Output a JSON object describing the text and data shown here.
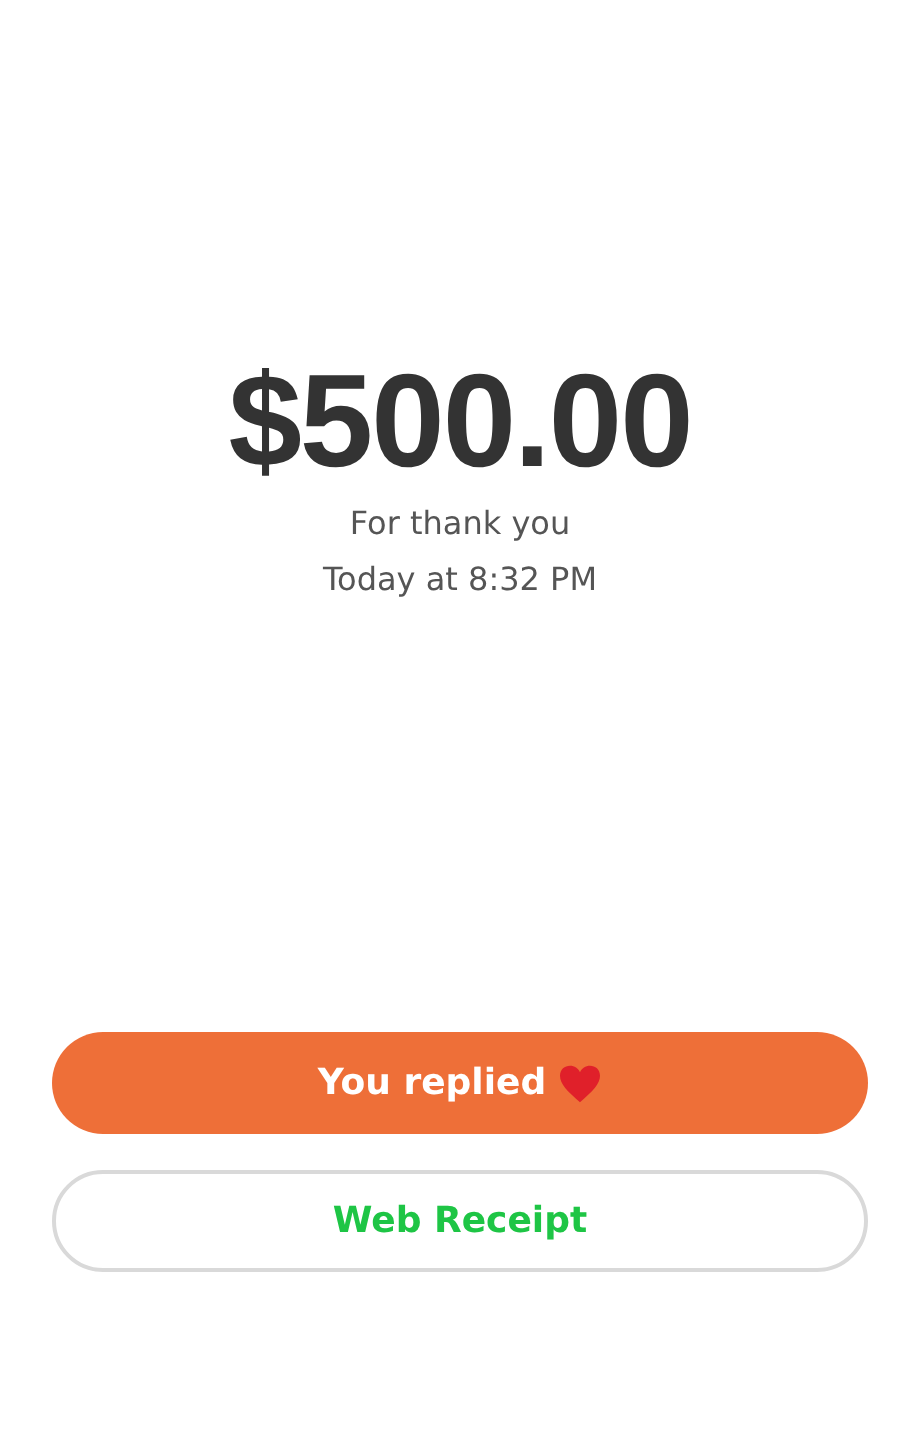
{
  "amount": "$500.00",
  "note": "For thank you",
  "time": "Today at 8:32 PM",
  "buttons": [
    {
      "kind": "filled",
      "label": "You replied",
      "heart": true
    },
    {
      "kind": "outline",
      "label": "Web Receipt",
      "heart": false
    }
  ]
}
